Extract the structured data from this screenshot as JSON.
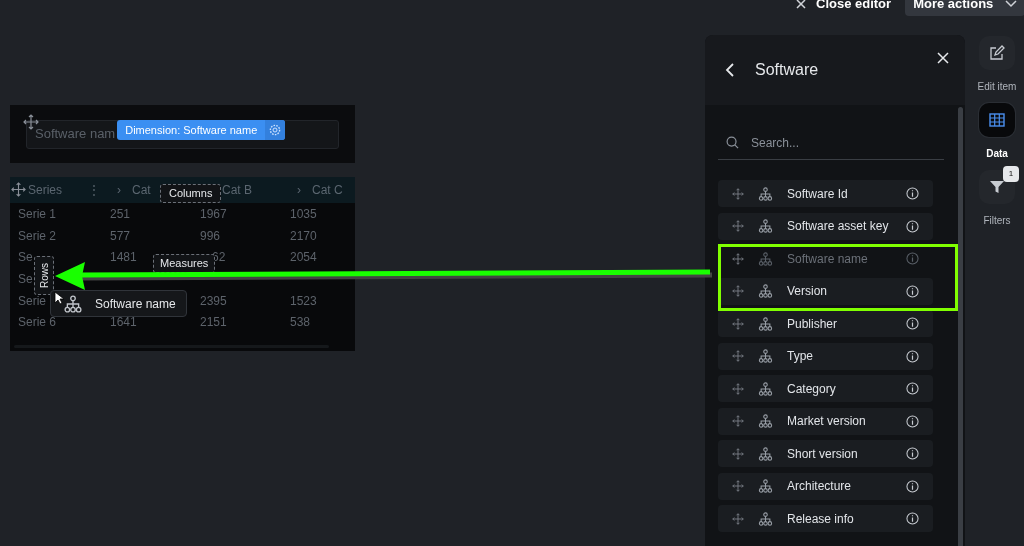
{
  "top_bar": {
    "close_label": "Close editor",
    "more_label": "More actions"
  },
  "filter_widget": {
    "placeholder": "Software nam",
    "badge": "Dimension: Software name"
  },
  "table": {
    "header": [
      "Series",
      "⋮",
      "›",
      "Cat",
      "Cat B",
      "›",
      "Cat C"
    ],
    "rows": [
      {
        "cells": [
          "Serie 1",
          "251",
          "1967",
          "1035"
        ]
      },
      {
        "cells": [
          "Serie 2",
          "577",
          "996",
          "2170"
        ]
      },
      {
        "cells": [
          "Se",
          "1481",
          "62",
          "2054"
        ]
      },
      {
        "cells": [
          "Se",
          null,
          null,
          null
        ]
      },
      {
        "cells": [
          "Serie",
          null,
          "2395",
          "1523"
        ]
      },
      {
        "cells": [
          "Serie 6",
          "1641",
          "2151",
          "538"
        ]
      }
    ],
    "drop_zones": {
      "columns": "Columns",
      "measures": "Measures",
      "rows": "Rows"
    },
    "drag_chip": "Software name"
  },
  "panel": {
    "title": "Software",
    "search_placeholder": "Search...",
    "items": [
      {
        "label": "Software Id",
        "dragging": false
      },
      {
        "label": "Software asset key",
        "dragging": false
      },
      {
        "label": "Software name",
        "dragging": true
      },
      {
        "label": "Version",
        "dragging": false
      },
      {
        "label": "Publisher",
        "dragging": false
      },
      {
        "label": "Type",
        "dragging": false
      },
      {
        "label": "Category",
        "dragging": false
      },
      {
        "label": "Market version",
        "dragging": false
      },
      {
        "label": "Short version",
        "dragging": false
      },
      {
        "label": "Architecture",
        "dragging": false
      },
      {
        "label": "Release info",
        "dragging": false
      }
    ]
  },
  "side_tabs": [
    {
      "kind": "edit",
      "label": "Edit item",
      "selected": false
    },
    {
      "kind": "data",
      "label": "Data",
      "selected": true
    },
    {
      "kind": "filters",
      "label": "Filters",
      "selected": false,
      "badge": "1"
    }
  ]
}
